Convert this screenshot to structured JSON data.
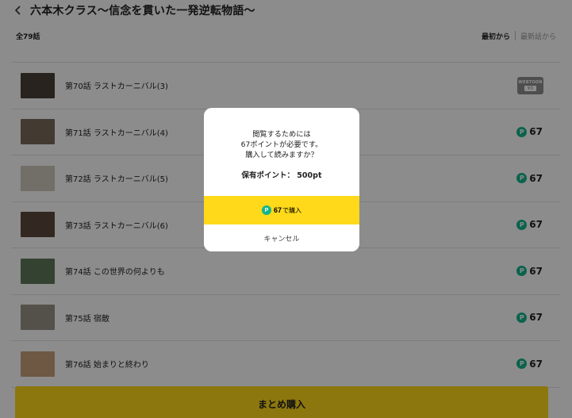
{
  "header": {
    "title": "六本木クラス〜信念を貫いた一発逆転物語〜"
  },
  "subbar": {
    "count": "全79話",
    "sort_first": "最初から",
    "sort_latest": "最新話から"
  },
  "episodes": [
    {
      "label": "第70話 ラストカーニバル(3)",
      "thumb_color": "#4a4038",
      "price_type": "webtoon",
      "badge_text": "WEBTOON",
      "badge_yen": "¥0"
    },
    {
      "label": "第71話 ラストカーニバル(4)",
      "thumb_color": "#7a6a5c",
      "price_type": "points",
      "price": "67"
    },
    {
      "label": "第72話 ラストカーニバル(5)",
      "thumb_color": "#cfc9bd",
      "price_type": "points",
      "price": "67"
    },
    {
      "label": "第73話 ラストカーニバル(6)",
      "thumb_color": "#5b4a3c",
      "price_type": "points",
      "price": "67"
    },
    {
      "label": "第74話 この世界の何よりも",
      "thumb_color": "#5f7a5a",
      "price_type": "points",
      "price": "67"
    },
    {
      "label": "第75話 宿敵",
      "thumb_color": "#9a9489",
      "price_type": "points",
      "price": "67"
    },
    {
      "label": "第76話 始まりと終わり",
      "thumb_color": "#c9a07a",
      "price_type": "points",
      "price": "67"
    }
  ],
  "bulk_button": "まとめ購入",
  "point_icon": "P",
  "modal": {
    "message_line1": "閲覧するためには",
    "message_line2": "67ポイントが必要です。",
    "message_line3": "購入して読みますか？",
    "balance": "保有ポイント： 500pt",
    "buy_price": "67",
    "buy_suffix": "で購入",
    "cancel": "キャンセル"
  },
  "colors": {
    "accent": "#ffd91a",
    "point_green": "#14b58a"
  }
}
